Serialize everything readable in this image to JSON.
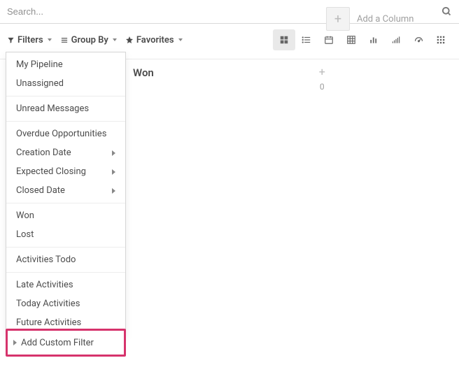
{
  "search": {
    "placeholder": "Search..."
  },
  "toolbar": {
    "filters_label": "Filters",
    "groupby_label": "Group By",
    "favorites_label": "Favorites"
  },
  "views": {
    "active": "kanban"
  },
  "kanban": {
    "columns": [
      {
        "title": "Won",
        "count": "0"
      }
    ],
    "add_column_label": "Add a Column"
  },
  "filters_dropdown": {
    "groups": [
      [
        {
          "label": "My Pipeline",
          "submenu": false
        },
        {
          "label": "Unassigned",
          "submenu": false
        }
      ],
      [
        {
          "label": "Unread Messages",
          "submenu": false
        }
      ],
      [
        {
          "label": "Overdue Opportunities",
          "submenu": false
        },
        {
          "label": "Creation Date",
          "submenu": true
        },
        {
          "label": "Expected Closing",
          "submenu": true
        },
        {
          "label": "Closed Date",
          "submenu": true
        }
      ],
      [
        {
          "label": "Won",
          "submenu": false
        },
        {
          "label": "Lost",
          "submenu": false
        }
      ],
      [
        {
          "label": "Activities Todo",
          "submenu": false
        }
      ],
      [
        {
          "label": "Late Activities",
          "submenu": false
        },
        {
          "label": "Today Activities",
          "submenu": false
        },
        {
          "label": "Future Activities",
          "submenu": false
        }
      ]
    ],
    "add_custom_label": "Add Custom Filter"
  }
}
